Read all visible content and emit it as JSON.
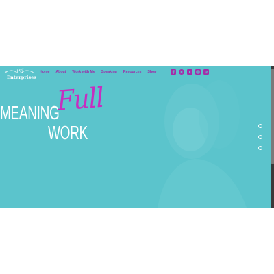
{
  "header": {
    "logo": {
      "script_text": "Pd",
      "name": "Enterprises"
    },
    "nav": [
      {
        "label": "Home"
      },
      {
        "label": "About"
      },
      {
        "label": "Work with Me"
      },
      {
        "label": "Speaking"
      },
      {
        "label": "Resources"
      },
      {
        "label": "Shop"
      }
    ],
    "social_icons": [
      "facebook-icon",
      "twitter-icon",
      "youtube-icon",
      "instagram-icon",
      "linkedin-icon"
    ]
  },
  "hero": {
    "word_1": "MEANING",
    "word_2": "Full",
    "word_3": "WORK",
    "slider_dots": 3
  },
  "colors": {
    "hero_bg": "#5bc4cc",
    "accent": "#c62ec0",
    "nav_text": "#9b2fa8"
  }
}
